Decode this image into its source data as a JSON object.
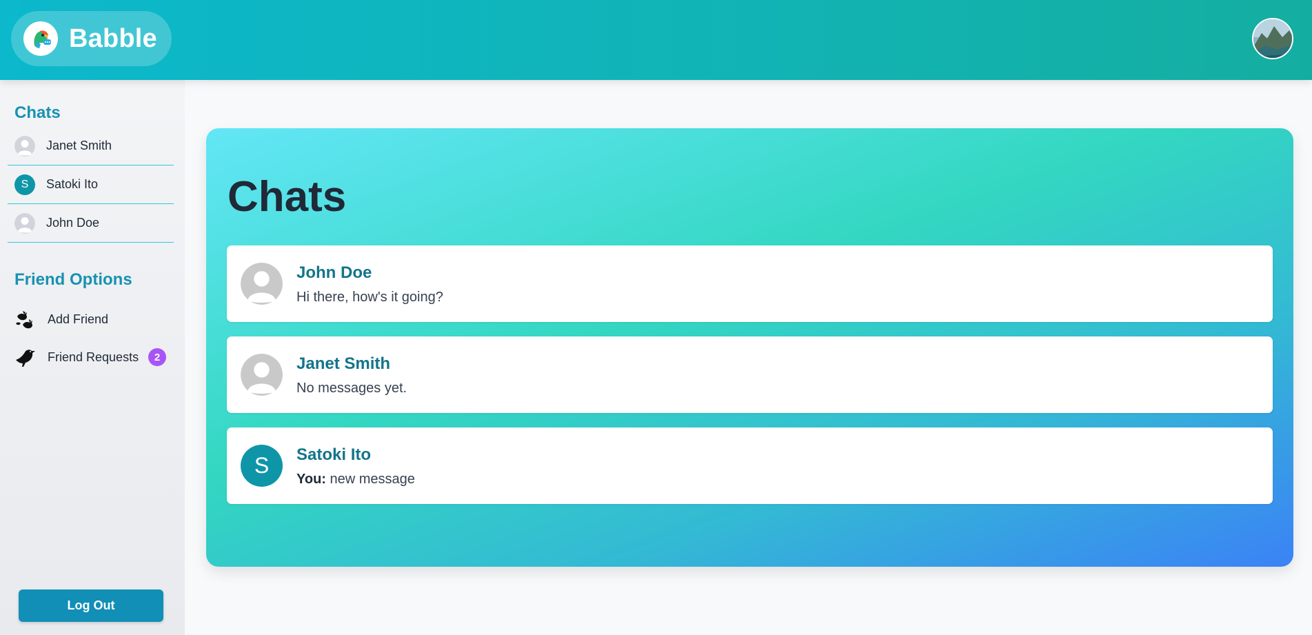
{
  "header": {
    "brand_name": "Babble",
    "logo_icon": "parrot-logo-icon",
    "user_avatar_icon": "user-photo-avatar"
  },
  "sidebar": {
    "chats_title": "Chats",
    "chats": [
      {
        "name": "Janet Smith",
        "avatar": "default-avatar-icon"
      },
      {
        "name": "Satoki Ito",
        "avatar_letter": "S"
      },
      {
        "name": "John Doe",
        "avatar": "default-avatar-icon"
      }
    ],
    "friend_options_title": "Friend Options",
    "friend_options": [
      {
        "label": "Add Friend",
        "icon": "birds-icon"
      },
      {
        "label": "Friend Requests",
        "icon": "bird-icon",
        "badge": "2"
      }
    ],
    "logout_label": "Log Out"
  },
  "main": {
    "title": "Chats",
    "conversations": [
      {
        "name": "John Doe",
        "preview": "Hi there, how's it going?",
        "avatar": "default-avatar-icon"
      },
      {
        "name": "Janet Smith",
        "preview": "No messages yet.",
        "avatar": "default-avatar-icon"
      },
      {
        "name": "Satoki Ito",
        "preview_prefix": "You:",
        "preview": " new message",
        "avatar_letter": "S"
      }
    ]
  },
  "colors": {
    "accent": "#1792b2",
    "badge": "#a855f7",
    "header_start": "#0bb8cc",
    "header_end": "#14aea1",
    "letter_avatar": "#0e96a8"
  }
}
